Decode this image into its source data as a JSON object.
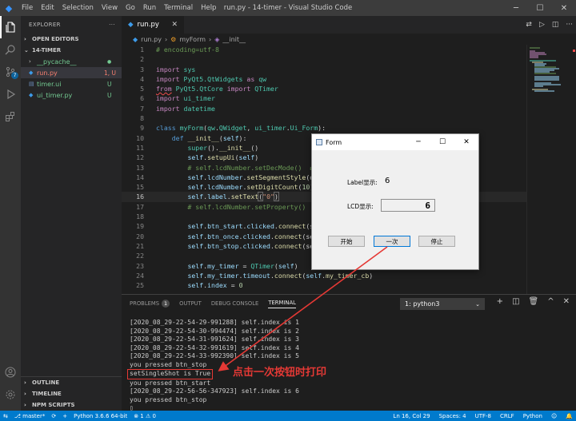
{
  "titlebar": {
    "menu": [
      "File",
      "Edit",
      "Selection",
      "View",
      "Go",
      "Run",
      "Terminal",
      "Help"
    ],
    "title": "run.py - 14-timer - Visual Studio Code"
  },
  "activity": {
    "scm_badge": "7"
  },
  "sidebar": {
    "header": "EXPLORER",
    "open_editors": "OPEN EDITORS",
    "folder": "14-TIMER",
    "files": [
      {
        "name": "__pycache__",
        "status": "●",
        "color": "#73c991"
      },
      {
        "name": "run.py",
        "status": "1, U",
        "color": "#f88070"
      },
      {
        "name": "timer.ui",
        "status": "U",
        "color": "#73c991"
      },
      {
        "name": "ui_timer.py",
        "status": "U",
        "color": "#73c991"
      }
    ],
    "outline": "OUTLINE",
    "timeline": "TIMELINE",
    "npm": "NPM SCRIPTS"
  },
  "editor": {
    "tab_label": "run.py",
    "breadcrumb": [
      "run.py",
      "myForm",
      "__init__"
    ]
  },
  "code_lines": [
    {
      "n": "1"
    },
    {
      "n": "2"
    },
    {
      "n": "3"
    },
    {
      "n": "4"
    },
    {
      "n": "5"
    },
    {
      "n": "6"
    },
    {
      "n": "7"
    },
    {
      "n": "8"
    },
    {
      "n": "9"
    },
    {
      "n": "10"
    },
    {
      "n": "11"
    },
    {
      "n": "12"
    },
    {
      "n": "13"
    },
    {
      "n": "14"
    },
    {
      "n": "15"
    },
    {
      "n": "16"
    },
    {
      "n": "17"
    },
    {
      "n": "18"
    },
    {
      "n": "19"
    },
    {
      "n": "20"
    },
    {
      "n": "21"
    },
    {
      "n": "22"
    },
    {
      "n": "23"
    },
    {
      "n": "24"
    },
    {
      "n": "25"
    }
  ],
  "panel": {
    "tabs": [
      "PROBLEMS",
      "OUTPUT",
      "DEBUG CONSOLE",
      "TERMINAL"
    ],
    "problems_count": "1",
    "terminal_select": "1: python3",
    "terminal_lines": [
      "[2020_08_29-22-54-29-991288] self.index is 1",
      "[2020_08_29-22-54-30-994474] self.index is 2",
      "[2020_08_29-22-54-31-991624] self.index is 3",
      "[2020_08_29-22-54-32-991619] self.index is 4",
      "[2020_08_29-22-54-33-992390] self.index is 5",
      "you pressed btn_stop"
    ],
    "highlight_line": "setSingleShot is True",
    "after_lines": [
      "you pressed btn_start",
      "[2020_08_29-22-56-56-347923] self.index is 6",
      "you pressed btn_stop"
    ],
    "annotation": "点击一次按钮时打印"
  },
  "form": {
    "title": "Form",
    "label_caption": "Label显示:",
    "label_value": "6",
    "lcd_caption": "LCD显示:",
    "lcd_value": "6",
    "buttons": [
      "开始",
      "一次",
      "停止"
    ]
  },
  "status": {
    "branch": "master*",
    "python": "Python 3.6.6 64-bit",
    "problems": "⊗ 1 ⚠ 0",
    "position": "Ln 16, Col 29",
    "spaces": "Spaces: 4",
    "encoding": "UTF-8",
    "eol": "CRLF",
    "language": "Python"
  }
}
